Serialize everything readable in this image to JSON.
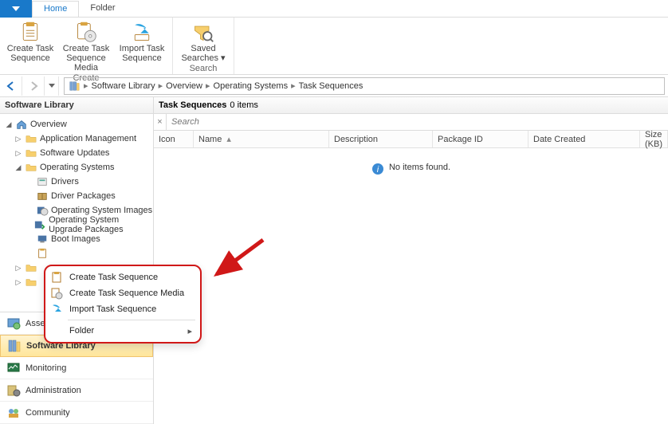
{
  "tabs": {
    "home": "Home",
    "folder": "Folder"
  },
  "ribbon": {
    "create_group": "Create",
    "search_group": "Search",
    "btn_create_ts": "Create Task\nSequence",
    "btn_create_ts_media": "Create Task\nSequence Media",
    "btn_import_ts": "Import Task\nSequence",
    "btn_saved_searches": "Saved\nSearches ▾"
  },
  "breadcrumb": {
    "root": "Software Library",
    "b1": "Overview",
    "b2": "Operating Systems",
    "b3": "Task Sequences"
  },
  "nav": {
    "title": "Software Library",
    "overview": "Overview",
    "app_mgmt": "Application Management",
    "sw_updates": "Software Updates",
    "os": "Operating Systems",
    "drivers": "Drivers",
    "driver_pkgs": "Driver Packages",
    "os_images": "Operating System Images",
    "os_upgrade": "Operating System Upgrade Packages",
    "boot_images": "Boot Images",
    "bottom": {
      "assets": "Assets and Compliance",
      "swlib": "Software Library",
      "monitoring": "Monitoring",
      "admin": "Administration",
      "community": "Community"
    }
  },
  "context_menu": {
    "create_ts": "Create Task Sequence",
    "create_ts_media": "Create Task Sequence Media",
    "import_ts": "Import Task Sequence",
    "folder": "Folder"
  },
  "content": {
    "title": "Task Sequences",
    "count": "0 items",
    "search_placeholder": "Search",
    "cols": {
      "icon": "Icon",
      "name": "Name",
      "description": "Description",
      "package_id": "Package ID",
      "date_created": "Date Created",
      "size": "Size (KB)"
    },
    "empty": "No items found."
  }
}
